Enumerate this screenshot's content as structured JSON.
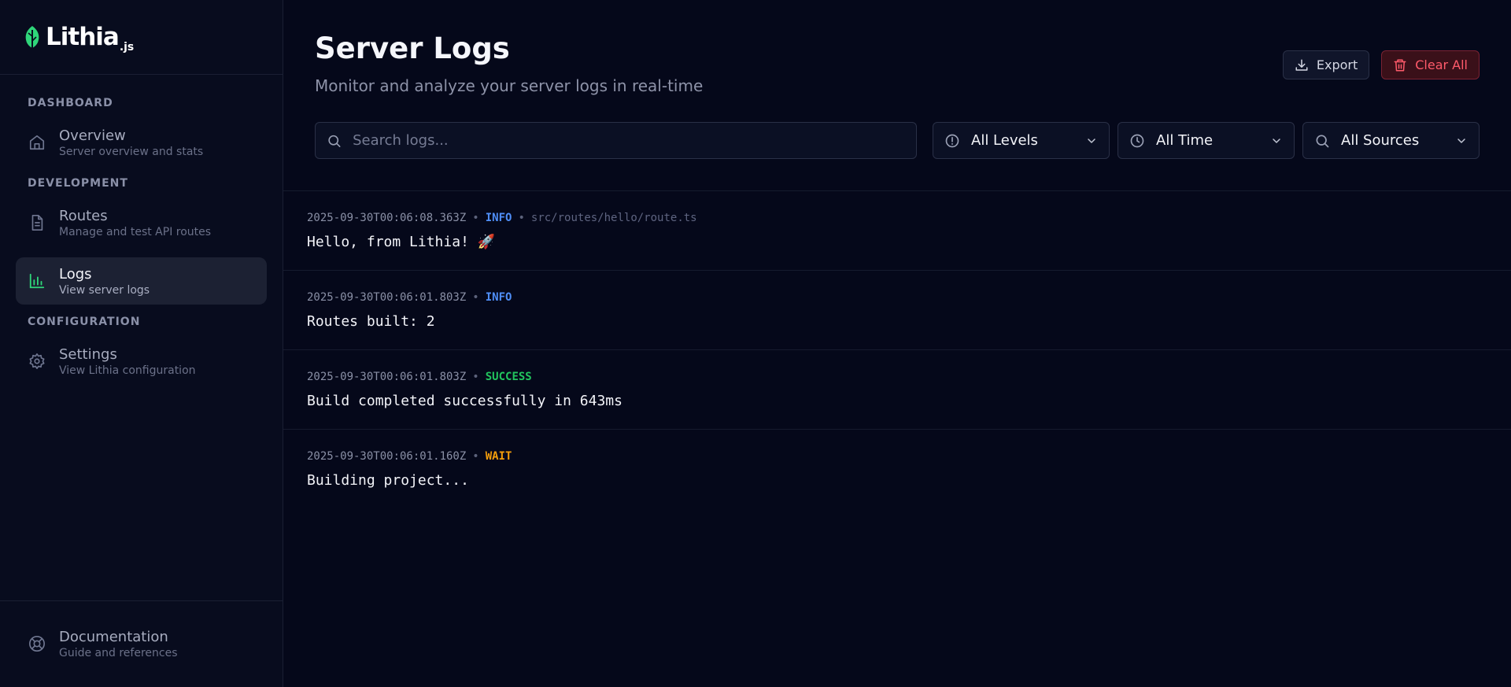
{
  "brand": {
    "name": "Lithia",
    "suffix": ".js"
  },
  "sidebar": {
    "sections": [
      {
        "title": "DASHBOARD"
      },
      {
        "title": "DEVELOPMENT"
      },
      {
        "title": "CONFIGURATION"
      }
    ],
    "items": [
      {
        "label": "Overview",
        "desc": "Server overview and stats",
        "icon": "home-icon"
      },
      {
        "label": "Routes",
        "desc": "Manage and test API routes",
        "icon": "file-icon"
      },
      {
        "label": "Logs",
        "desc": "View server logs",
        "icon": "bar-chart-icon",
        "active": true
      },
      {
        "label": "Settings",
        "desc": "View Lithia configuration",
        "icon": "gear-icon"
      }
    ],
    "footer": {
      "label": "Documentation",
      "desc": "Guide and references",
      "icon": "lifebuoy-icon"
    }
  },
  "header": {
    "title": "Server Logs",
    "subtitle": "Monitor and analyze your server logs in real-time",
    "export_label": "Export",
    "clear_label": "Clear All"
  },
  "filters": {
    "search_placeholder": "Search logs...",
    "level": "All Levels",
    "time": "All Time",
    "source": "All Sources"
  },
  "colors": {
    "accent": "#2fd67a",
    "info": "#4f8ef7",
    "success": "#22c55e",
    "wait": "#f59e0b",
    "danger": "#ff5a6a"
  },
  "logs": [
    {
      "timestamp": "2025-09-30T00:06:08.363Z",
      "level": "INFO",
      "source": "src/routes/hello/route.ts",
      "message": "Hello, from Lithia! 🚀"
    },
    {
      "timestamp": "2025-09-30T00:06:01.803Z",
      "level": "INFO",
      "message": "Routes built: 2"
    },
    {
      "timestamp": "2025-09-30T00:06:01.803Z",
      "level": "SUCCESS",
      "message": "Build completed successfully in 643ms"
    },
    {
      "timestamp": "2025-09-30T00:06:01.160Z",
      "level": "WAIT",
      "message": "Building project..."
    }
  ]
}
